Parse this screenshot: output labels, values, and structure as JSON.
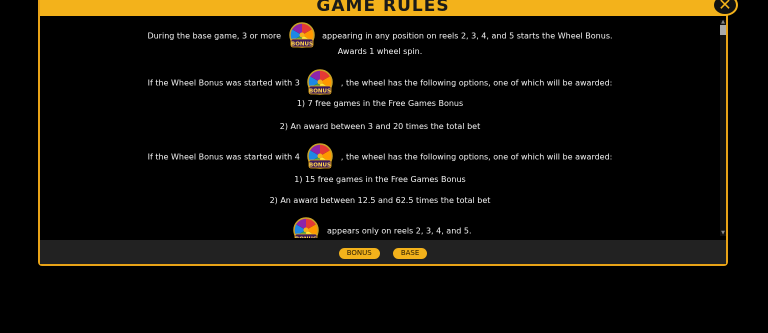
{
  "header": {
    "title": "GAME RULES",
    "close_glyph": "✕"
  },
  "rules": {
    "p1_pre": "During the base game, 3 or more",
    "p1_post": "appearing in any position on reels 2, 3, 4, and 5 starts the Wheel Bonus.",
    "p2": "Awards 1 wheel spin.",
    "p3_pre": "If the Wheel Bonus was started with 3",
    "p3_post": ", the wheel has the following options, one of which will be awarded:",
    "p4": "1) 7 free games in the Free Games Bonus",
    "p5": "2) An award between 3 and 20 times the total bet",
    "p6_pre": "If the Wheel Bonus was started with 4",
    "p6_post": ", the wheel has the following options, one of which will be awarded:",
    "p7": "1) 15 free games in the Free Games Bonus",
    "p8": "2) An award between 12.5 and 62.5 times the total bet",
    "p9_post": "appears only on reels 2, 3, 4, and 5."
  },
  "bonus_symbol": {
    "label": "BONUS",
    "icon": "bonus-wheel-icon",
    "colors": [
      "#e53935",
      "#ff9800",
      "#ffeb3b",
      "#43a047",
      "#1e88e5",
      "#8e24aa"
    ]
  },
  "footer": {
    "tabs": [
      "BONUS",
      "BASE"
    ]
  },
  "colors": {
    "accent": "#f3b21b",
    "background": "#000000",
    "text": "#f2f2f2"
  }
}
